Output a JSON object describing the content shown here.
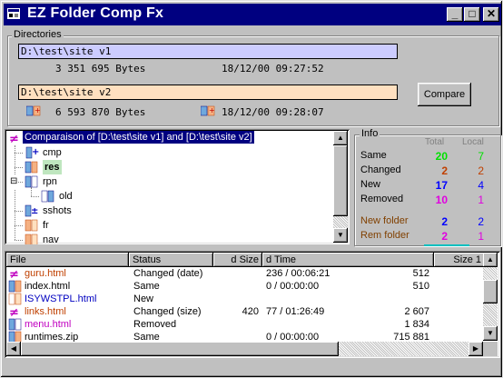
{
  "window": {
    "title": "EZ Folder Comp Fx",
    "min_label": "_",
    "max_label": "□",
    "close_label": "✕"
  },
  "directories": {
    "group_label": "Directories",
    "dir1": {
      "path": "D:\\test\\site v1",
      "size": "3 351 695 Bytes",
      "date": "18/12/00 09:27:52",
      "field_color": "#ccccff"
    },
    "dir2": {
      "path": "D:\\test\\site v2",
      "size": "6 593 870 Bytes",
      "date": "18/12/00 09:28:07",
      "field_color": "#ffe0c0"
    },
    "compare_label": "Compare"
  },
  "tree": {
    "root_label": "Comparaison of [D:\\test\\site v1] and [D:\\test\\site v2]",
    "items": [
      {
        "label": "cmp",
        "icon": "plus-folder-icon"
      },
      {
        "label": "res",
        "icon": "changed-folder-icon"
      },
      {
        "label": "rpn",
        "icon": "both-folder-icon",
        "expander": "⊟"
      },
      {
        "label": "old",
        "icon": "new-folder-icon"
      },
      {
        "label": "sshots",
        "icon": "plusminus-folder-icon"
      },
      {
        "label": "fr",
        "icon": "same-folder-icon"
      },
      {
        "label": "nav",
        "icon": "same-folder-icon"
      }
    ]
  },
  "info": {
    "group_label": "Info",
    "col_total": "Total",
    "col_local": "Local",
    "rows": [
      {
        "label": "Same",
        "total": "20",
        "local": "7",
        "color": "#00e000"
      },
      {
        "label": "Changed",
        "total": "2",
        "local": "2",
        "color": "#c04000"
      },
      {
        "label": "New",
        "total": "17",
        "local": "4",
        "color": "#0000ff"
      },
      {
        "label": "Removed",
        "total": "10",
        "local": "1",
        "color": "#e000e0"
      }
    ],
    "folder_rows": [
      {
        "label": "New folder",
        "total": "2",
        "local": "2",
        "label_color": "#804000",
        "total_color": "#0000ff",
        "local_color": "#0000ff"
      },
      {
        "label": "Rem folder",
        "total": "2",
        "local": "1",
        "label_color": "#804000",
        "total_color": "#e000e0",
        "local_color": "#e000e0"
      }
    ]
  },
  "file_list": {
    "columns": [
      "File",
      "Status",
      "d Size",
      "d Time",
      "Size 1"
    ],
    "rows": [
      {
        "file": "guru.html",
        "status": "Changed (date)",
        "dsize": "",
        "dtime": "236 / 00:06:21",
        "size1": "512",
        "color": "#c04000",
        "icon": "changed-file-icon"
      },
      {
        "file": "index.html",
        "status": "Same",
        "dsize": "",
        "dtime": "0 / 00:00:00",
        "size1": "510",
        "color": "#000000",
        "icon": "same-file-icon"
      },
      {
        "file": "ISYWSTPL.html",
        "status": "New",
        "dsize": "",
        "dtime": "",
        "size1": "",
        "color": "#0000c0",
        "icon": "new-file-icon"
      },
      {
        "file": "links.html",
        "status": "Changed (size)",
        "dsize": "420",
        "dtime": "77 / 01:26:49",
        "size1": "2 607",
        "color": "#c04000",
        "icon": "changed-file-icon"
      },
      {
        "file": "menu.html",
        "status": "Removed",
        "dsize": "",
        "dtime": "",
        "size1": "1 834",
        "color": "#c000c0",
        "icon": "removed-file-icon"
      },
      {
        "file": "runtimes.zip",
        "status": "Same",
        "dsize": "",
        "dtime": "0 / 00:00:00",
        "size1": "715 881",
        "color": "#000000",
        "icon": "same-file-icon"
      }
    ]
  }
}
